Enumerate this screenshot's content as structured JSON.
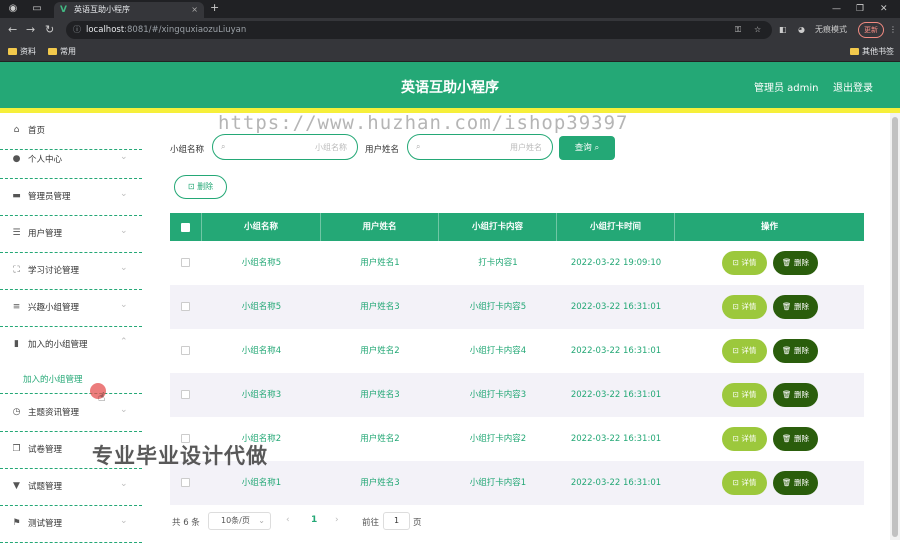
{
  "browser": {
    "tab_title": "英语互助小程序",
    "url_host": "localhost",
    "url_rest": ":8081/#/xingquxiaozuLiuyan",
    "incognito_label": "无痕模式",
    "update_label": "更新",
    "bookmarks": [
      "资料",
      "常用"
    ],
    "other_bookmarks": "其他书签"
  },
  "header": {
    "title": "英语互助小程序",
    "user": "管理员 admin",
    "logout": "退出登录"
  },
  "watermark": {
    "url": "https://www.huzhan.com/ishop39397",
    "text": "专业毕业设计代做"
  },
  "sidebar": {
    "items": [
      {
        "label": "首页",
        "icon": "home-icon",
        "glyph": "⌂"
      },
      {
        "label": "个人中心",
        "icon": "user-icon",
        "glyph": "●"
      },
      {
        "label": "管理员管理",
        "icon": "admin-icon",
        "glyph": "▬"
      },
      {
        "label": "用户管理",
        "icon": "list-icon",
        "glyph": "☰"
      },
      {
        "label": "学习讨论管理",
        "icon": "frame-icon",
        "glyph": "⛶"
      },
      {
        "label": "兴趣小组管理",
        "icon": "menu-icon",
        "glyph": "≡"
      },
      {
        "label": "加入的小组管理",
        "icon": "chart-icon",
        "glyph": "▮"
      },
      {
        "label": "主题资讯管理",
        "icon": "clock-icon",
        "glyph": "◷"
      },
      {
        "label": "试卷管理",
        "icon": "copy-icon",
        "glyph": "❐"
      },
      {
        "label": "试题管理",
        "icon": "trophy-icon",
        "glyph": "▼"
      },
      {
        "label": "测试管理",
        "icon": "flag-icon",
        "glyph": "⚑"
      }
    ],
    "submenu_item": "加入的小组管理"
  },
  "search": {
    "group_name_label": "小组名称",
    "group_name_placeholder": "小组名称",
    "user_name_label": "用户姓名",
    "user_name_placeholder": "用户姓名",
    "query_button": "查询 ⌕",
    "delete_button": "⊡ 删除"
  },
  "table": {
    "headers": [
      "小组名称",
      "用户姓名",
      "小组打卡内容",
      "小组打卡时间",
      "操作"
    ],
    "rows": [
      {
        "group": "小组名称5",
        "user": "用户姓名1",
        "content": "打卡内容1",
        "time": "2022-03-22 19:09:10"
      },
      {
        "group": "小组名称5",
        "user": "用户姓名3",
        "content": "小组打卡内容5",
        "time": "2022-03-22 16:31:01"
      },
      {
        "group": "小组名称4",
        "user": "用户姓名2",
        "content": "小组打卡内容4",
        "time": "2022-03-22 16:31:01"
      },
      {
        "group": "小组名称3",
        "user": "用户姓名3",
        "content": "小组打卡内容3",
        "time": "2022-03-22 16:31:01"
      },
      {
        "group": "小组名称2",
        "user": "用户姓名2",
        "content": "小组打卡内容2",
        "time": "2022-03-22 16:31:01"
      },
      {
        "group": "小组名称1",
        "user": "用户姓名3",
        "content": "小组打卡内容1",
        "time": "2022-03-22 16:31:01"
      }
    ],
    "detail_label": "⊡ 详情",
    "delete_label": "🗑 删除"
  },
  "pagination": {
    "total": "共 6 条",
    "page_size": "10条/页",
    "current_page": "1",
    "goto_label": "前往",
    "goto_value": "1",
    "page_suffix": "页"
  },
  "colors": {
    "primary": "#24a876",
    "accent_yellow": "#f6ef3a",
    "detail_button": "#9cc83c",
    "delete_button": "#2a5d0c"
  }
}
